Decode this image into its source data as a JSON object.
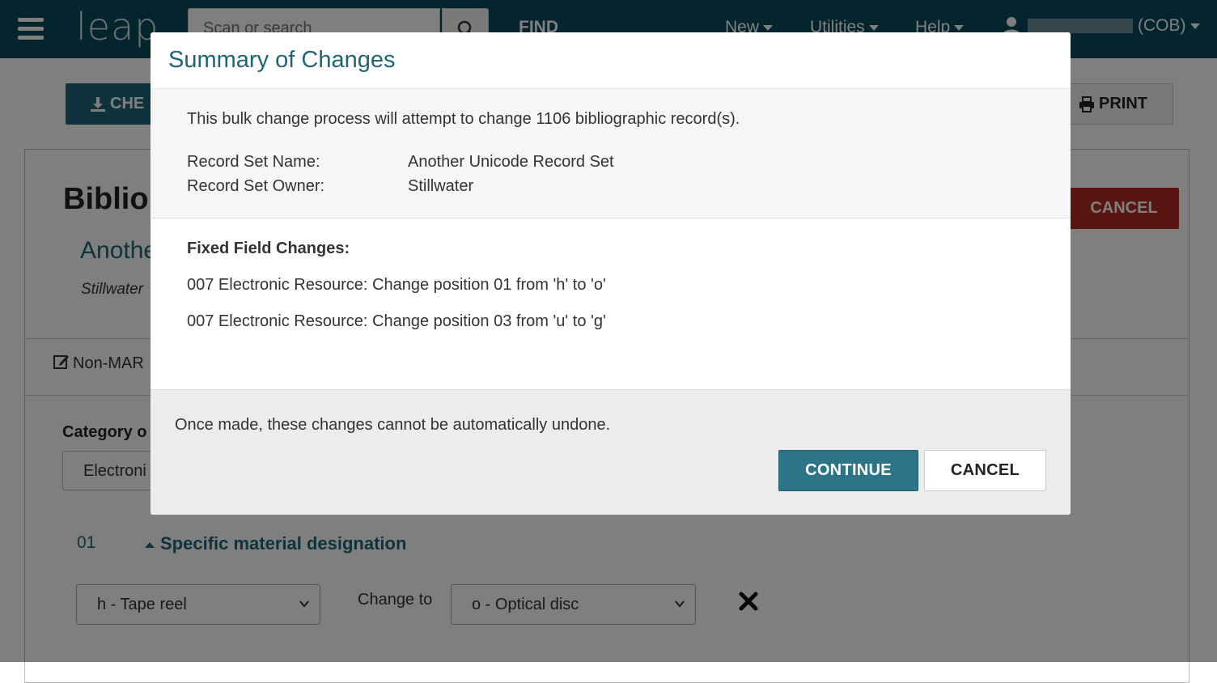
{
  "navbar": {
    "logo": "leap",
    "search_placeholder": "Scan or search",
    "find_label": "FIND",
    "menus": [
      "New",
      "Utilities",
      "Help"
    ],
    "user_suffix": "(COB)"
  },
  "page": {
    "checkout_label": "CHE",
    "print_label": "PRINT",
    "title": "Biblio",
    "cancel_label": "CANCEL",
    "record_set_name": "Anothe",
    "record_set_owner": "Stillwater",
    "tab_label": "Non-MAR",
    "category_label": "Category o",
    "category_value": "Electroni",
    "position": {
      "number": "01",
      "title": "Specific material designation",
      "from_value": "h - Tape reel",
      "change_to_label": "Change to",
      "to_value": "o - Optical disc"
    }
  },
  "modal": {
    "title": "Summary of Changes",
    "intro": "This bulk change process will attempt to change 1106 bibliographic record(s).",
    "meta": [
      {
        "label": "Record Set Name:",
        "value": "Another Unicode Record Set"
      },
      {
        "label": "Record Set Owner:",
        "value": "Stillwater"
      }
    ],
    "changes_heading": "Fixed Field Changes:",
    "changes": [
      "007 Electronic Resource: Change position 01 from 'h' to 'o'",
      "007 Electronic Resource: Change position 03 from 'u' to 'g'"
    ],
    "warning": "Once made, these changes cannot be automatically undone.",
    "continue_label": "CONTINUE",
    "cancel_label": "CANCEL"
  },
  "colors": {
    "navbar": "#0a4a5c",
    "accent": "#1d6678",
    "danger": "#b32b1e"
  }
}
